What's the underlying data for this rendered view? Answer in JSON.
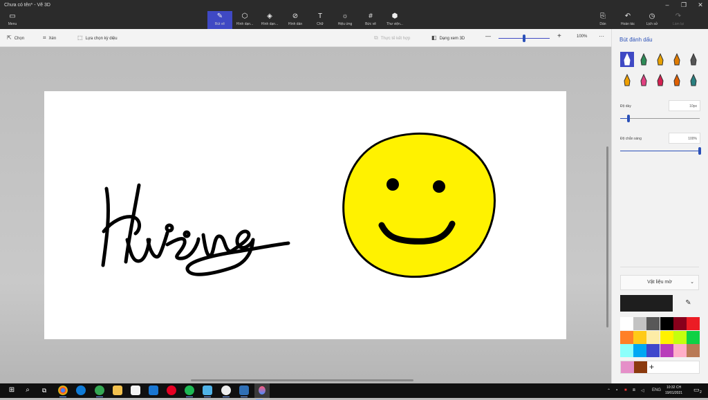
{
  "window": {
    "title": "Chưa có tên* - Vẽ 3D",
    "controls": [
      "–",
      "❐",
      "✕"
    ]
  },
  "ribbon": {
    "menu_label": "Menu",
    "tools": [
      {
        "label": "Bút vẽ",
        "icon": "brush-icon",
        "glyph": "✎",
        "active": true
      },
      {
        "label": "Hình dạn...",
        "icon": "2d-shapes-icon",
        "glyph": "⬡",
        "active": false
      },
      {
        "label": "Hình dạn...",
        "icon": "3d-shapes-icon",
        "glyph": "◈",
        "active": false
      },
      {
        "label": "Hình dán",
        "icon": "stickers-icon",
        "glyph": "⊘",
        "active": false
      },
      {
        "label": "Chữ",
        "icon": "text-icon",
        "glyph": "T",
        "active": false
      },
      {
        "label": "Hiệu ứng",
        "icon": "effects-icon",
        "glyph": "☼",
        "active": false
      },
      {
        "label": "Bức vẽ",
        "icon": "canvas-icon",
        "glyph": "#",
        "active": false
      },
      {
        "label": "Thư viện...",
        "icon": "3d-library-icon",
        "glyph": "⬢",
        "active": false
      }
    ],
    "right_tools": [
      {
        "label": "Dán",
        "icon": "paste-icon",
        "glyph": "⎘",
        "disabled": false
      },
      {
        "label": "Hoàn tác",
        "icon": "undo-icon",
        "glyph": "↶",
        "disabled": false
      },
      {
        "label": "Lịch sử",
        "icon": "history-icon",
        "glyph": "◷",
        "disabled": false
      },
      {
        "label": "Làm lại",
        "icon": "redo-icon",
        "glyph": "↷",
        "disabled": true
      }
    ]
  },
  "commandbar": {
    "select": "Chọn",
    "crop": "Xén",
    "magic_select": "Lựa chọn kỳ diệu",
    "mixed_reality": "Thực tế kết hợp",
    "view_3d": "Dạng xem 3D",
    "zoom_minus": "—",
    "zoom_plus": "+",
    "zoom_value": "100%",
    "zoom_fraction": 0.5,
    "more": "···"
  },
  "panel": {
    "title": "Bút đánh dấu",
    "thickness_label": "Độ dày",
    "thickness_value": "10px",
    "thickness_fraction": 0.1,
    "opacity_label": "Độ chắn sáng",
    "opacity_value": "100%",
    "opacity_fraction": 1.0,
    "material_label": "Vật liệu mờ",
    "current_color": "#1e1e1e",
    "palette": [
      "#ffffff",
      "#c3c3c3",
      "#585858",
      "#000000",
      "#88001b",
      "#ec1c24",
      "#ff7f27",
      "#ffca18",
      "#fdeca6",
      "#fff200",
      "#c4ff0e",
      "#0ed145",
      "#8cfffb",
      "#00a8f3",
      "#3f48cc",
      "#b83dba",
      "#ffaec8",
      "#b97a56"
    ],
    "custom_colors": [
      "#e58fc8",
      "#8b3a0e"
    ],
    "add_color": "+"
  },
  "canvas": {
    "background": "#ffffff",
    "ink_color": "#000000",
    "face_fill": "#fff200"
  },
  "taskbar": {
    "tray_lang": "ENG",
    "clock_time": "10:32 CH",
    "clock_date": "19/01/2021",
    "notification_count": "2"
  }
}
